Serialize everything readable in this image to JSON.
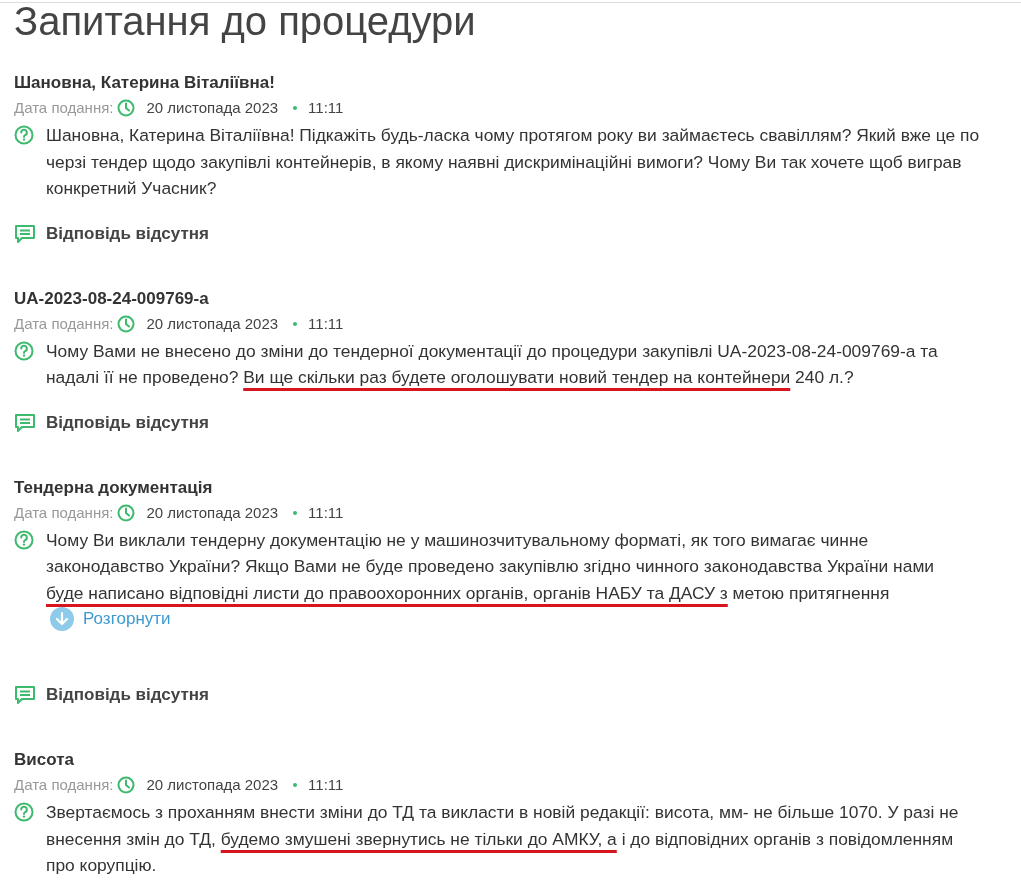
{
  "title": "Запитання до процедури",
  "questions": [
    {
      "title": "Шановна, Катерина Віталіївна!",
      "date_label": "Дата подання:",
      "date": "20 листопада 2023",
      "time": "11:11",
      "lines": [
        [
          {
            "text": "Шановна, Катерина Віталіївна! Підкажіть будь-ласка чому протягом року ви займаєтесь свавіллям? Який вже це по",
            "underlined": false
          }
        ],
        [
          {
            "text": "черзі тендер щодо закупівлі контейнерів, в якому наявні дискримінаційні вимоги? Чому Ви так хочете щоб виграв",
            "underlined": false
          }
        ],
        [
          {
            "text": "конкретний Учасник?",
            "underlined": false
          }
        ]
      ],
      "answer": "Відповідь відсутня"
    },
    {
      "title": "UA-2023-08-24-009769-a",
      "date_label": "Дата подання:",
      "date": "20 листопада 2023",
      "time": "11:11",
      "lines": [
        [
          {
            "text": "Чому Вами не внесено до зміни до тендерної документації до процедури закупівлі UA-2023-08-24-009769-a та",
            "underlined": false
          }
        ],
        [
          {
            "text": "надалі її не проведено? ",
            "underlined": false
          },
          {
            "text": "Ви ще скільки раз будете оголошувати новий тендер на контейнери",
            "underlined": true
          },
          {
            "text": " 240 л.?",
            "underlined": false
          }
        ]
      ],
      "answer": "Відповідь відсутня"
    },
    {
      "title": "Тендерна документація",
      "date_label": "Дата подання:",
      "date": "20 листопада 2023",
      "time": "11:11",
      "lines": [
        [
          {
            "text": "Чому Ви виклали тендерну документацію не у машинозчитувальному форматі, як того вимагає чинне",
            "underlined": false
          }
        ],
        [
          {
            "text": "законодавство України? Якщо Вами не буде проведено закупівлю згідно чинного законодавства України нами",
            "underlined": false
          }
        ],
        [
          {
            "text": "буде написано відповідні листи до правоохоронних органів, органів НАБУ та ДАСУ з",
            "underlined": true
          },
          {
            "text": " метою притягнення",
            "underlined": false
          }
        ]
      ],
      "expand": "Розгорнути",
      "answer": "Відповідь відсутня"
    },
    {
      "title": "Висота",
      "date_label": "Дата подання:",
      "date": "20 листопада 2023",
      "time": "11:11",
      "lines": [
        [
          {
            "text": "Звертаємось з проханням внести зміни до ТД та викласти в новій редакції: висота, мм- не більше 1070. У разі не",
            "underlined": false
          }
        ],
        [
          {
            "text": "внесення змін до ТД, ",
            "underlined": false
          },
          {
            "text": "будемо змушені звернутись не тільки до АМКУ, а",
            "underlined": true
          },
          {
            "text": " і до відповідних органів з повідомленням",
            "underlined": false
          }
        ],
        [
          {
            "text": "про корупцію.",
            "underlined": false
          }
        ]
      ]
    }
  ]
}
